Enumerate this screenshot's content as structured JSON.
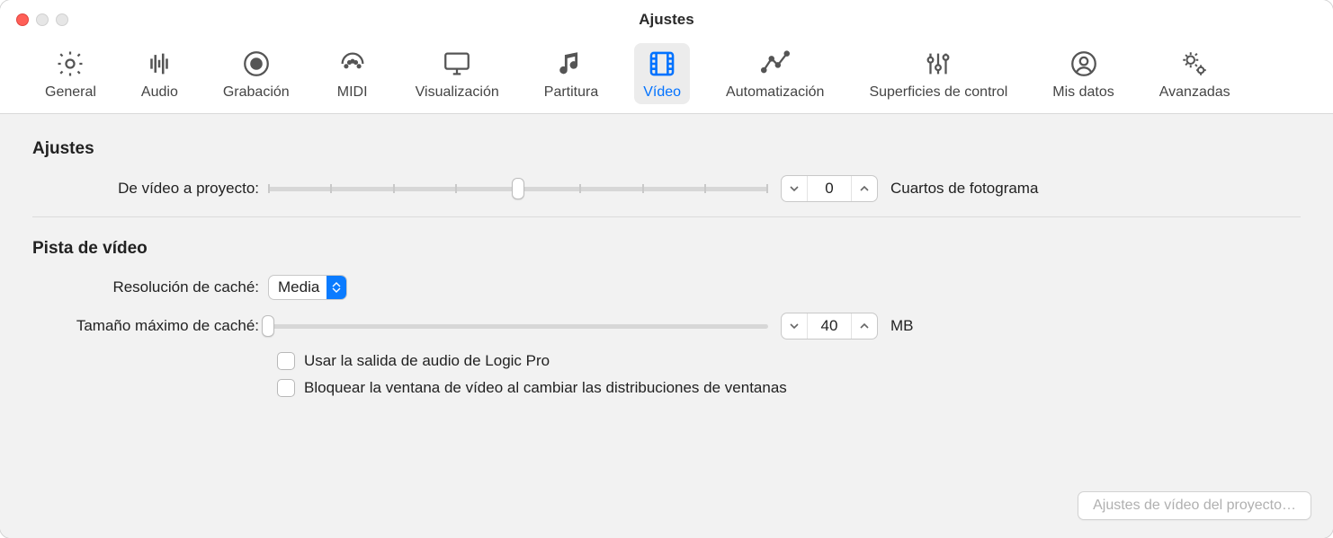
{
  "window": {
    "title": "Ajustes"
  },
  "toolbar": {
    "items": [
      {
        "id": "general",
        "label": "General"
      },
      {
        "id": "audio",
        "label": "Audio"
      },
      {
        "id": "recording",
        "label": "Grabación"
      },
      {
        "id": "midi",
        "label": "MIDI"
      },
      {
        "id": "display",
        "label": "Visualización"
      },
      {
        "id": "score",
        "label": "Partitura"
      },
      {
        "id": "video",
        "label": "Vídeo"
      },
      {
        "id": "automation",
        "label": "Automatización"
      },
      {
        "id": "surfaces",
        "label": "Superficies de control"
      },
      {
        "id": "mydata",
        "label": "Mis datos"
      },
      {
        "id": "advanced",
        "label": "Avanzadas"
      }
    ],
    "active_id": "video"
  },
  "settings_section": {
    "title": "Ajustes",
    "video_to_project": {
      "label": "De vídeo a proyecto:",
      "value": "0",
      "unit": "Cuartos de fotograma",
      "slider_pos": 0.5
    }
  },
  "video_track_section": {
    "title": "Pista de vídeo",
    "cache_resolution": {
      "label": "Resolución de caché:",
      "value": "Media"
    },
    "max_cache": {
      "label": "Tamaño máximo de caché:",
      "value": "40",
      "unit": "MB",
      "slider_pos": 0.0
    },
    "checkbox_audio_output": {
      "label": "Usar la salida de audio de Logic Pro",
      "checked": false
    },
    "checkbox_lock_window": {
      "label": "Bloquear la ventana de vídeo al cambiar las distribuciones de ventanas",
      "checked": false
    }
  },
  "footer": {
    "project_video_settings": "Ajustes de vídeo del proyecto…"
  }
}
